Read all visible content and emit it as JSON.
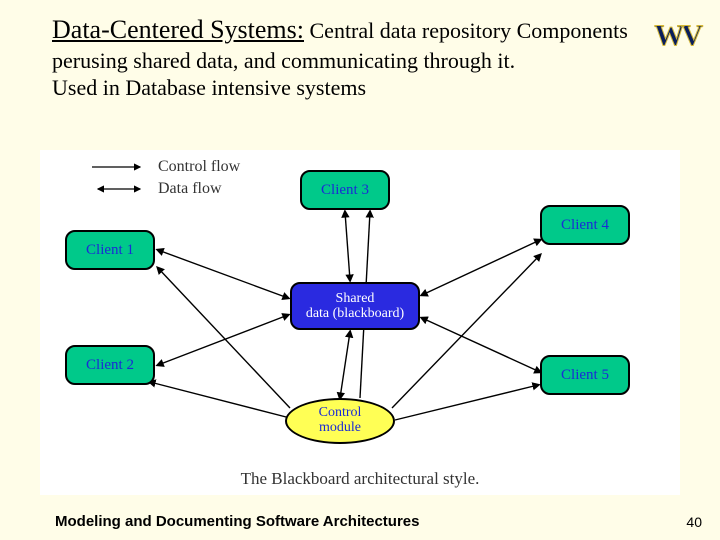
{
  "title": {
    "lead": "Data-Centered Systems:",
    "rest": " Central data repository Components perusing shared data, and communicating through it.",
    "line3": "Used in Database intensive systems"
  },
  "legend": {
    "control": "Control flow",
    "data": "Data flow"
  },
  "nodes": {
    "client1": "Client 1",
    "client2": "Client 2",
    "client3": "Client 3",
    "client4": "Client 4",
    "client5": "Client 5",
    "shared": "Shared\ndata (blackboard)",
    "control": "Control\nmodule"
  },
  "caption": "The Blackboard architectural style.",
  "footer": "Modeling and Documenting Software Architectures",
  "page": "40",
  "logo_text": "WV"
}
